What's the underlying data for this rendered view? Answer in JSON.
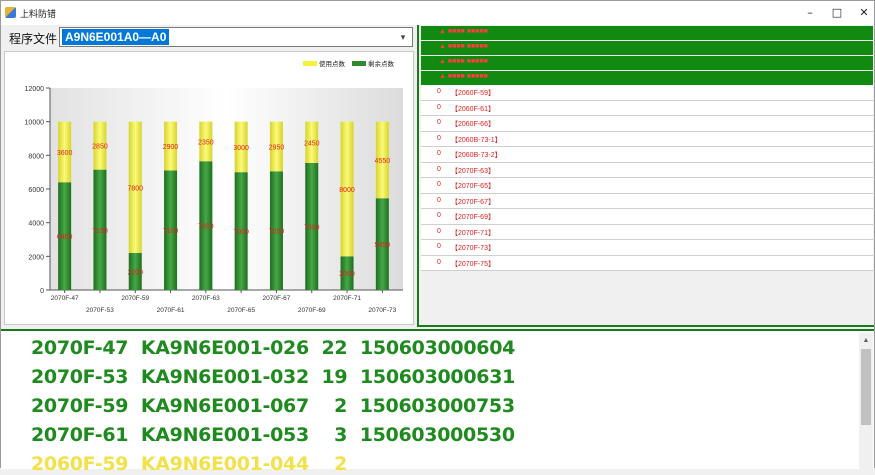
{
  "window": {
    "title": "上料防错",
    "controls": {
      "minimize": "–",
      "maximize": "□",
      "close": "✕"
    }
  },
  "toolbar": {
    "program_label": "程序文件",
    "program_value": "A9N6E001A0—A0",
    "dropdown_icon": "chevron-down-icon"
  },
  "chart_data": {
    "type": "bar",
    "stacked": true,
    "categories": [
      "2070F-47",
      "2070F-53",
      "2070F-59",
      "2070F-61",
      "2070F-63",
      "2070F-65",
      "2070F-67",
      "2070F-69",
      "2070F-71",
      "2070F-73"
    ],
    "series": [
      {
        "name": "剩余点数",
        "color": "#2e8b2e",
        "values": [
          6400,
          7150,
          2200,
          7100,
          7650,
          7000,
          7050,
          7550,
          2000,
          5450
        ]
      },
      {
        "name": "使用点数",
        "color": "#f4f23a",
        "values": [
          3600,
          2850,
          7800,
          2900,
          2350,
          3000,
          2950,
          2450,
          8000,
          4550
        ]
      }
    ],
    "bar_labels": {
      "remaining": [
        "6400",
        "7150",
        "2200",
        "7100",
        "7650",
        "7000",
        "7050",
        "7550",
        "2000",
        "5450"
      ],
      "used": [
        "3600",
        "2850",
        "7800",
        "2900",
        "2350",
        "3000",
        "2950",
        "2450",
        "8000",
        "4550"
      ]
    },
    "ylim": [
      0,
      12000
    ],
    "yticks": [
      "0",
      "2000",
      "4000",
      "6000",
      "8000",
      "10000",
      "12000"
    ],
    "legend": "top-right",
    "grid": false,
    "xlabel": "",
    "ylabel": ""
  },
  "right_panel": {
    "green_rows": [
      "▲ ■■■■ ■■■■■",
      "▲ ■■■■ ■■■■■",
      "▲ ■■■■ ■■■■■",
      "▲ ■■■■ ■■■■■"
    ],
    "list": [
      {
        "num": "0",
        "code": "【2060F-59】"
      },
      {
        "num": "0",
        "code": "【2060F-61】"
      },
      {
        "num": "0",
        "code": "【2060F-66】"
      },
      {
        "num": "0",
        "code": "【2060B-73-1】"
      },
      {
        "num": "0",
        "code": "【2060B-73-2】"
      },
      {
        "num": "0",
        "code": "【2070F-63】"
      },
      {
        "num": "0",
        "code": "【2070F-65】"
      },
      {
        "num": "0",
        "code": "【2070F-67】"
      },
      {
        "num": "0",
        "code": "【2070F-69】"
      },
      {
        "num": "0",
        "code": "【2070F-71】"
      },
      {
        "num": "0",
        "code": "【2070F-73】"
      },
      {
        "num": "0",
        "code": "【2070F-75】"
      }
    ]
  },
  "log": {
    "lines": [
      {
        "text": "2070F-47  KA9N6E001-026  22  150603000604",
        "color": "#1f8a1f"
      },
      {
        "text": "2070F-53  KA9N6E001-032  19  150603000631",
        "color": "#1f8a1f"
      },
      {
        "text": "2070F-59  KA9N6E001-067    2  150603000753",
        "color": "#1f8a1f"
      },
      {
        "text": "2070F-61  KA9N6E001-053    3  150603000530",
        "color": "#1f8a1f"
      },
      {
        "text": "2060F-59  KA9N6E001-044    2",
        "color": "#f2e14a"
      }
    ],
    "scroll_up_icon": "scroll-up-arrow-icon"
  },
  "colors": {
    "accent_green": "#1a7a1a",
    "selection_blue": "#0078d7",
    "warning_red": "#e02020",
    "used_yellow": "#f4f23a",
    "remaining_green": "#2e8b2e"
  }
}
